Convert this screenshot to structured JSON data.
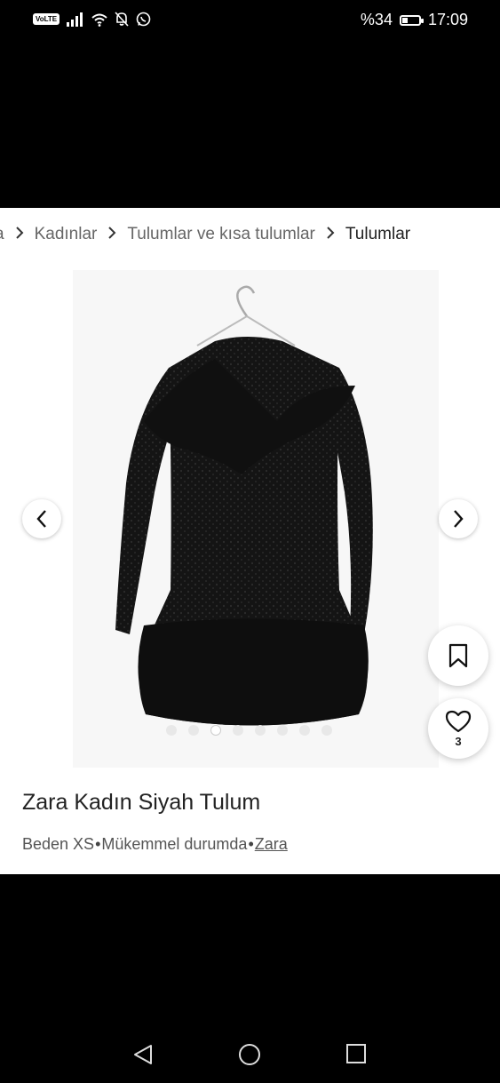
{
  "status_bar": {
    "volte": "VoLTE",
    "battery_text": "%34",
    "battery_level": 0.34,
    "time": "17:09"
  },
  "breadcrumb": {
    "partial": "a",
    "items": [
      "Kadınlar",
      "Tulumlar ve kısa tulumlar",
      "Tulumlar"
    ]
  },
  "gallery": {
    "image_count": 8,
    "active_index": 2
  },
  "favorites": {
    "count": "3"
  },
  "product": {
    "title": "Zara Kadın Siyah Tulum",
    "size": "Beden XS",
    "separator": "•",
    "condition": "Mükemmel durumda",
    "brand": "Zara"
  },
  "icons": {
    "prev": "chevron-left-icon",
    "next": "chevron-right-icon",
    "bookmark": "bookmark-icon",
    "favorite": "heart-icon",
    "back": "back-triangle-icon",
    "home": "home-circle-icon",
    "recents": "recents-square-icon"
  }
}
